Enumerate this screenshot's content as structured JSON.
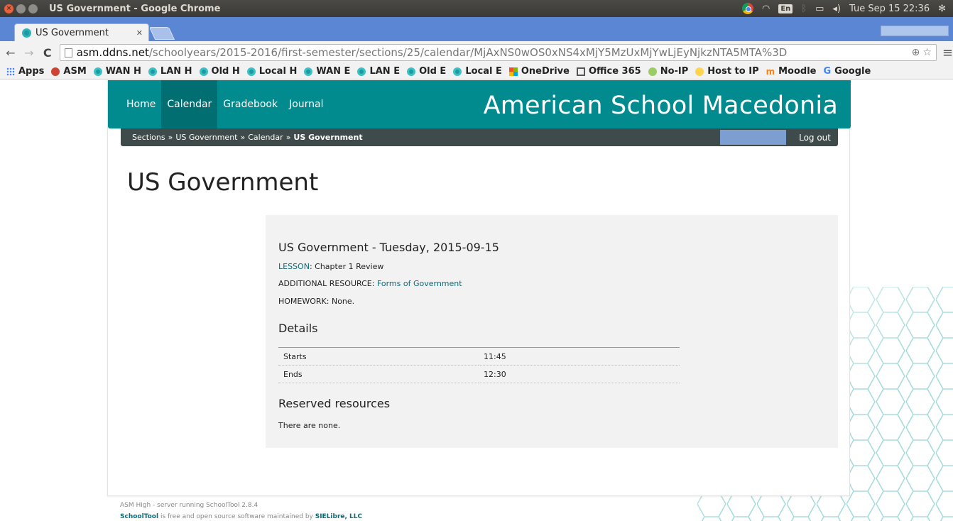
{
  "os": {
    "window_title": "US Government - Google Chrome",
    "lang": "En",
    "datetime": "Tue Sep 15 22:36"
  },
  "browser": {
    "tab_title": "US Government",
    "url_host": "asm.ddns.net",
    "url_path": "/schoolyears/2015-2016/first-semester/sections/25/calendar/MjAxNS0wOS0xNS4xMjY5MzUxMjYwLjEyNjkzNTA5MTA%3D",
    "bookmarks": [
      {
        "label": "Apps",
        "icon": "apps-icon"
      },
      {
        "label": "ASM",
        "icon": "asm-icon"
      },
      {
        "label": "WAN H",
        "icon": "schooltool-icon"
      },
      {
        "label": "LAN H",
        "icon": "schooltool-icon"
      },
      {
        "label": "Old H",
        "icon": "schooltool-icon"
      },
      {
        "label": "Local H",
        "icon": "schooltool-icon"
      },
      {
        "label": "WAN E",
        "icon": "schooltool-icon"
      },
      {
        "label": "LAN E",
        "icon": "schooltool-icon"
      },
      {
        "label": "Old E",
        "icon": "schooltool-icon"
      },
      {
        "label": "Local E",
        "icon": "schooltool-icon"
      },
      {
        "label": "OneDrive",
        "icon": "microsoft-icon"
      },
      {
        "label": "Office 365",
        "icon": "office-icon"
      },
      {
        "label": "No-IP",
        "icon": "noip-icon"
      },
      {
        "label": "Host to IP",
        "icon": "host-icon"
      },
      {
        "label": "Moodle",
        "icon": "moodle-icon"
      },
      {
        "label": "Google",
        "icon": "google-icon"
      }
    ]
  },
  "site": {
    "nav": [
      "Home",
      "Calendar",
      "Gradebook",
      "Journal"
    ],
    "active_nav": "Calendar",
    "name": "American School Macedonia",
    "breadcrumb": [
      "Sections",
      "US Government",
      "Calendar"
    ],
    "breadcrumb_current": "US Government",
    "logout": "Log out",
    "accent_color": "#018b8e"
  },
  "page": {
    "title": "US Government",
    "event_title": "US Government - Tuesday, 2015-09-15",
    "lesson_label": "LESSON",
    "lesson_value": ": Chapter 1 Review",
    "resource_label": "ADDITIONAL RESOURCE: ",
    "resource_link": "Forms of Government",
    "homework": "HOMEWORK: None.",
    "details_heading": "Details",
    "details": [
      {
        "label": "Starts",
        "value": "11:45"
      },
      {
        "label": "Ends",
        "value": "12:30"
      }
    ],
    "reserved_heading": "Reserved resources",
    "reserved_text": "There are none."
  },
  "footer": {
    "line1": "ASM High - server running SchoolTool 2.8.4",
    "schooltool": "SchoolTool",
    "line2_mid": " is free and open source software maintained by ",
    "sielibre": "SIELibre, LLC"
  }
}
